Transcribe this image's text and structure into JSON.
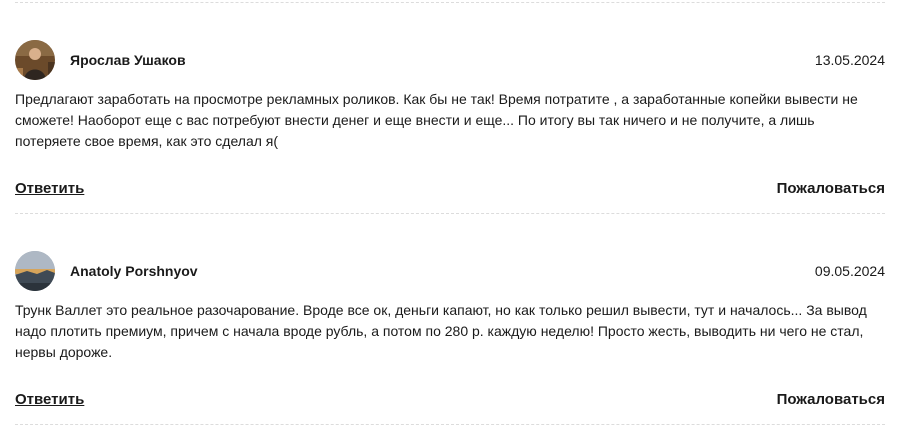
{
  "reviews": [
    {
      "author": "Ярослав Ушаков",
      "date": "13.05.2024",
      "text": "Предлагают заработать на просмотре рекламных роликов. Как бы не так! Время потратите , а заработанные копейки вывести не сможете! Наоборот еще с вас потребуют внести денег и еще внести и еще... По итогу вы так ничего и не получите, а лишь потеряете свое время, как это сделал я(",
      "reply_label": "Ответить",
      "report_label": "Пожаловаться"
    },
    {
      "author": "Anatoly Porshnyov",
      "date": "09.05.2024",
      "text": "Трунк Валлет это реальное разочарование. Вроде все ок, деньги капают, но как только решил вывести, тут и началось... За вывод надо плотить премиум, причем с начала вроде рубль, а потом по 280 р. каждую неделю! Просто жесть, выводить ни чего не стал, нервы дороже.",
      "reply_label": "Ответить",
      "report_label": "Пожаловаться"
    }
  ]
}
